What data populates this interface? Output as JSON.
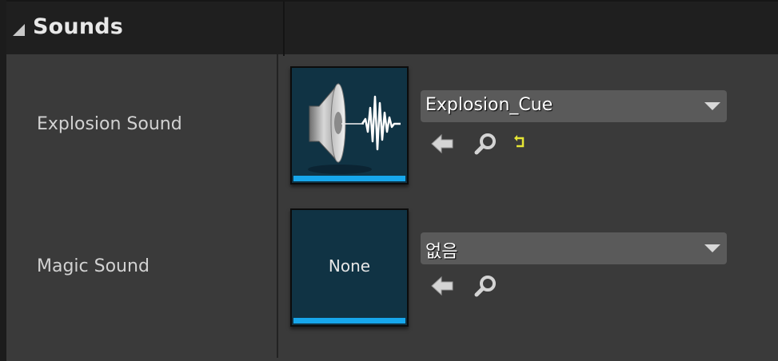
{
  "section": {
    "title": "Sounds",
    "collapse_icon": "triangle-down-icon"
  },
  "properties": [
    {
      "label": "Explosion Sound",
      "asset_value": "Explosion_Cue",
      "thumbnail_icon": "speaker-waveform-icon",
      "thumbnail_text": "",
      "buttons": [
        "use-selected-arrow-icon",
        "browse-magnifier-icon",
        "reset-to-default-icon"
      ]
    },
    {
      "label": "Magic Sound",
      "asset_value": "없음",
      "thumbnail_icon": "",
      "thumbnail_text": "None",
      "buttons": [
        "use-selected-arrow-icon",
        "browse-magnifier-icon"
      ]
    }
  ],
  "colors": {
    "thumbnail_bar": "#17a7ec",
    "reset_icon": "#e6e635",
    "panel_bg": "#3a3a3a",
    "header_bg": "#1f1f1f"
  }
}
